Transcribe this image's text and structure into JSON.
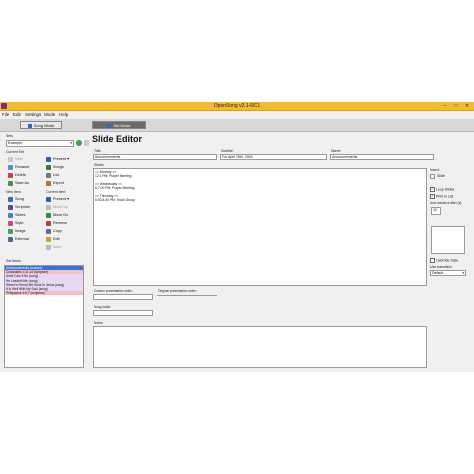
{
  "window": {
    "title": "OpenSong v2.1-RC1",
    "controls": {
      "minimize": "–",
      "maximize": "□",
      "close": "✕"
    }
  },
  "menu": [
    "File",
    "Edit",
    "Settings",
    "Mode",
    "Help"
  ],
  "modes": {
    "song": "Song Mode",
    "set": "Set Mode"
  },
  "sets": {
    "label": "Sets",
    "selected": "Example"
  },
  "current_set": {
    "label": "Current Set",
    "buttons": [
      "New",
      "Rename",
      "Delete",
      "Save As",
      "Present",
      "Songs",
      "List",
      "Export"
    ]
  },
  "new_item": {
    "label": "New Item",
    "buttons": [
      "Song",
      "Scripture",
      "Slides",
      "Style",
      "Image",
      "External"
    ]
  },
  "current_item": {
    "label": "Current Item",
    "buttons": [
      "Present",
      "Move Up",
      "Move Dn",
      "Remove",
      "Copy",
      "Edit",
      "Save"
    ]
  },
  "set_items": {
    "label": "Set Items",
    "items": [
      "Announcements (custom)",
      "Colossians 1:11-14 (scripture)",
      "Amid Cain It Be (song)",
      "He Leadeth Me (song)",
      "Where's Friend We Have In Jesus (song)",
      "It Is Well With My Soul (song)",
      "Philippians 4:6-7 (scripture)"
    ],
    "colors": [
      "#3a6fd8",
      "#f5c2c2",
      "#e8d7f5",
      "#e8d7f5",
      "#e8d7f5",
      "#e8d7f5",
      "#f5c2c2"
    ]
  },
  "editor": {
    "heading": "Slide Editor",
    "title_label": "Title:",
    "title_value": "Announcements",
    "subtitle_label": "Subtitle:",
    "subtitle_value": "For April 25th, 2004",
    "name_label": "Name:",
    "name_value": "Announcements",
    "slides_label": "Slides:",
    "slides_lines": [
      ">> Monday <<",
      "12:1 PM: Prayer Meeting",
      "",
      ">> Wednesday <<",
      "6-7:00 PM: Prayer Meeting",
      "",
      ">> Thursday <<",
      "6:30-8:30 PM: Youth Group"
    ],
    "insert_label": "Insert:",
    "insert_slide": "Slide",
    "loop_slides": "Loop Slides",
    "print_in_list": "Print in List",
    "auto_advance_label": "Auto advance after (s):",
    "auto_advance_value": "10",
    "override_style": "Override Style",
    "use_transition_label": "Use transition:",
    "transition_value": "Default",
    "custom_order_label": "Custom presentation order:",
    "original_order_label": "Original presentation order:",
    "song_folder_label": "Song folder:",
    "notes_label": "Notes:"
  },
  "colors": {
    "titlebar": "#f5bb2e",
    "selected_item": "#3a6fd8"
  }
}
